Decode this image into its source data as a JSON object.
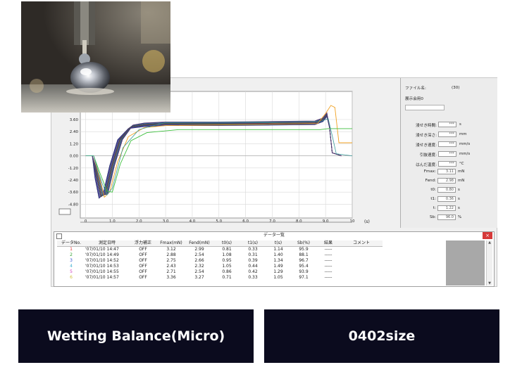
{
  "buttons": {
    "left_label": "Wetting Balance(Micro)",
    "right_label": "0402size"
  },
  "plot": {
    "y_ticks": [
      "3.60",
      "2.40",
      "1.20",
      "0.00",
      "-1.20",
      "-2.40",
      "-3.60",
      "-4.80"
    ],
    "x_ticks": [
      "0",
      "1.0",
      "2.0",
      "3.0",
      "4.0",
      "5.0",
      "6.0",
      "7.0",
      "8.0",
      "9.0",
      "10"
    ],
    "x_unit": "(s)",
    "colors": {
      "plot_bg": "#ffffff",
      "grid": "#cfcfcf",
      "curve_main": "#2a2a6a",
      "curve_orange": "#f0a020",
      "curve_green": "#3cbf3c"
    }
  },
  "right_panel": {
    "file_name_label": "ファイル名:",
    "file_name_value": "(30)",
    "sample_label": "展示会用0",
    "params": [
      {
        "label": "浸せき時間:",
        "value": "***",
        "unit": "s"
      },
      {
        "label": "浸せき深さ:",
        "value": "***",
        "unit": "mm"
      },
      {
        "label": "浸せき速度:",
        "value": "***",
        "unit": "mm/s"
      },
      {
        "label": "引抜速度:",
        "value": "***",
        "unit": "mm/s"
      },
      {
        "label": "はんだ温度:",
        "value": "***",
        "unit": "°C"
      }
    ],
    "results": [
      {
        "label": "Fmax:",
        "value": "3.11",
        "unit": "mN"
      },
      {
        "label": "Fend:",
        "value": "2.98",
        "unit": "mN"
      },
      {
        "label": "t0:",
        "value": "0.80",
        "unit": "s"
      },
      {
        "label": "t1:",
        "value": "0.36",
        "unit": "s"
      },
      {
        "label": "t:",
        "value": "1.22",
        "unit": "s"
      },
      {
        "label": "Sb:",
        "value": "96.0",
        "unit": "%"
      }
    ]
  },
  "table_window": {
    "title": "データ一覧",
    "close": "×",
    "headers": [
      "データNo.",
      "測定日時",
      "浮力補正",
      "Fmax(mN)",
      "Fend(mN)",
      "t0(s)",
      "t1(s)",
      "t(s)",
      "Sb(%)",
      "結果",
      "コメント"
    ],
    "rows": [
      {
        "no": "1",
        "no_color": "#e03030",
        "date": "'07/01/10 14:47",
        "comp": "OFF",
        "fmax": "3.12",
        "fend": "2.99",
        "t0": "0.81",
        "t1": "0.33",
        "t": "1.14",
        "sb": "95.9",
        "res": "-----"
      },
      {
        "no": "2",
        "no_color": "#30a030",
        "date": "'07/01/10 14:49",
        "comp": "OFF",
        "fmax": "2.88",
        "fend": "2.54",
        "t0": "1.08",
        "t1": "0.31",
        "t": "1.40",
        "sb": "88.1",
        "res": "-----"
      },
      {
        "no": "3",
        "no_color": "#3050d0",
        "date": "'07/01/10 14:52",
        "comp": "OFF",
        "fmax": "2.75",
        "fend": "2.66",
        "t0": "0.95",
        "t1": "0.39",
        "t": "1.34",
        "sb": "96.7",
        "res": "-----"
      },
      {
        "no": "4",
        "no_color": "#40b0d0",
        "date": "'07/01/10 14:53",
        "comp": "OFF",
        "fmax": "2.43",
        "fend": "2.32",
        "t0": "1.05",
        "t1": "0.44",
        "t": "1.49",
        "sb": "95.4",
        "res": "-----"
      },
      {
        "no": "5",
        "no_color": "#d040c0",
        "date": "'07/01/10 14:55",
        "comp": "OFF",
        "fmax": "2.71",
        "fend": "2.54",
        "t0": "0.86",
        "t1": "0.42",
        "t": "1.29",
        "sb": "93.9",
        "res": "-----"
      },
      {
        "no": "6",
        "no_color": "#d0c040",
        "date": "'07/01/10 14:57",
        "comp": "OFF",
        "fmax": "3.36",
        "fend": "3.27",
        "t0": "0.71",
        "t1": "0.33",
        "t": "1.05",
        "sb": "97.1",
        "res": "-----"
      }
    ]
  }
}
